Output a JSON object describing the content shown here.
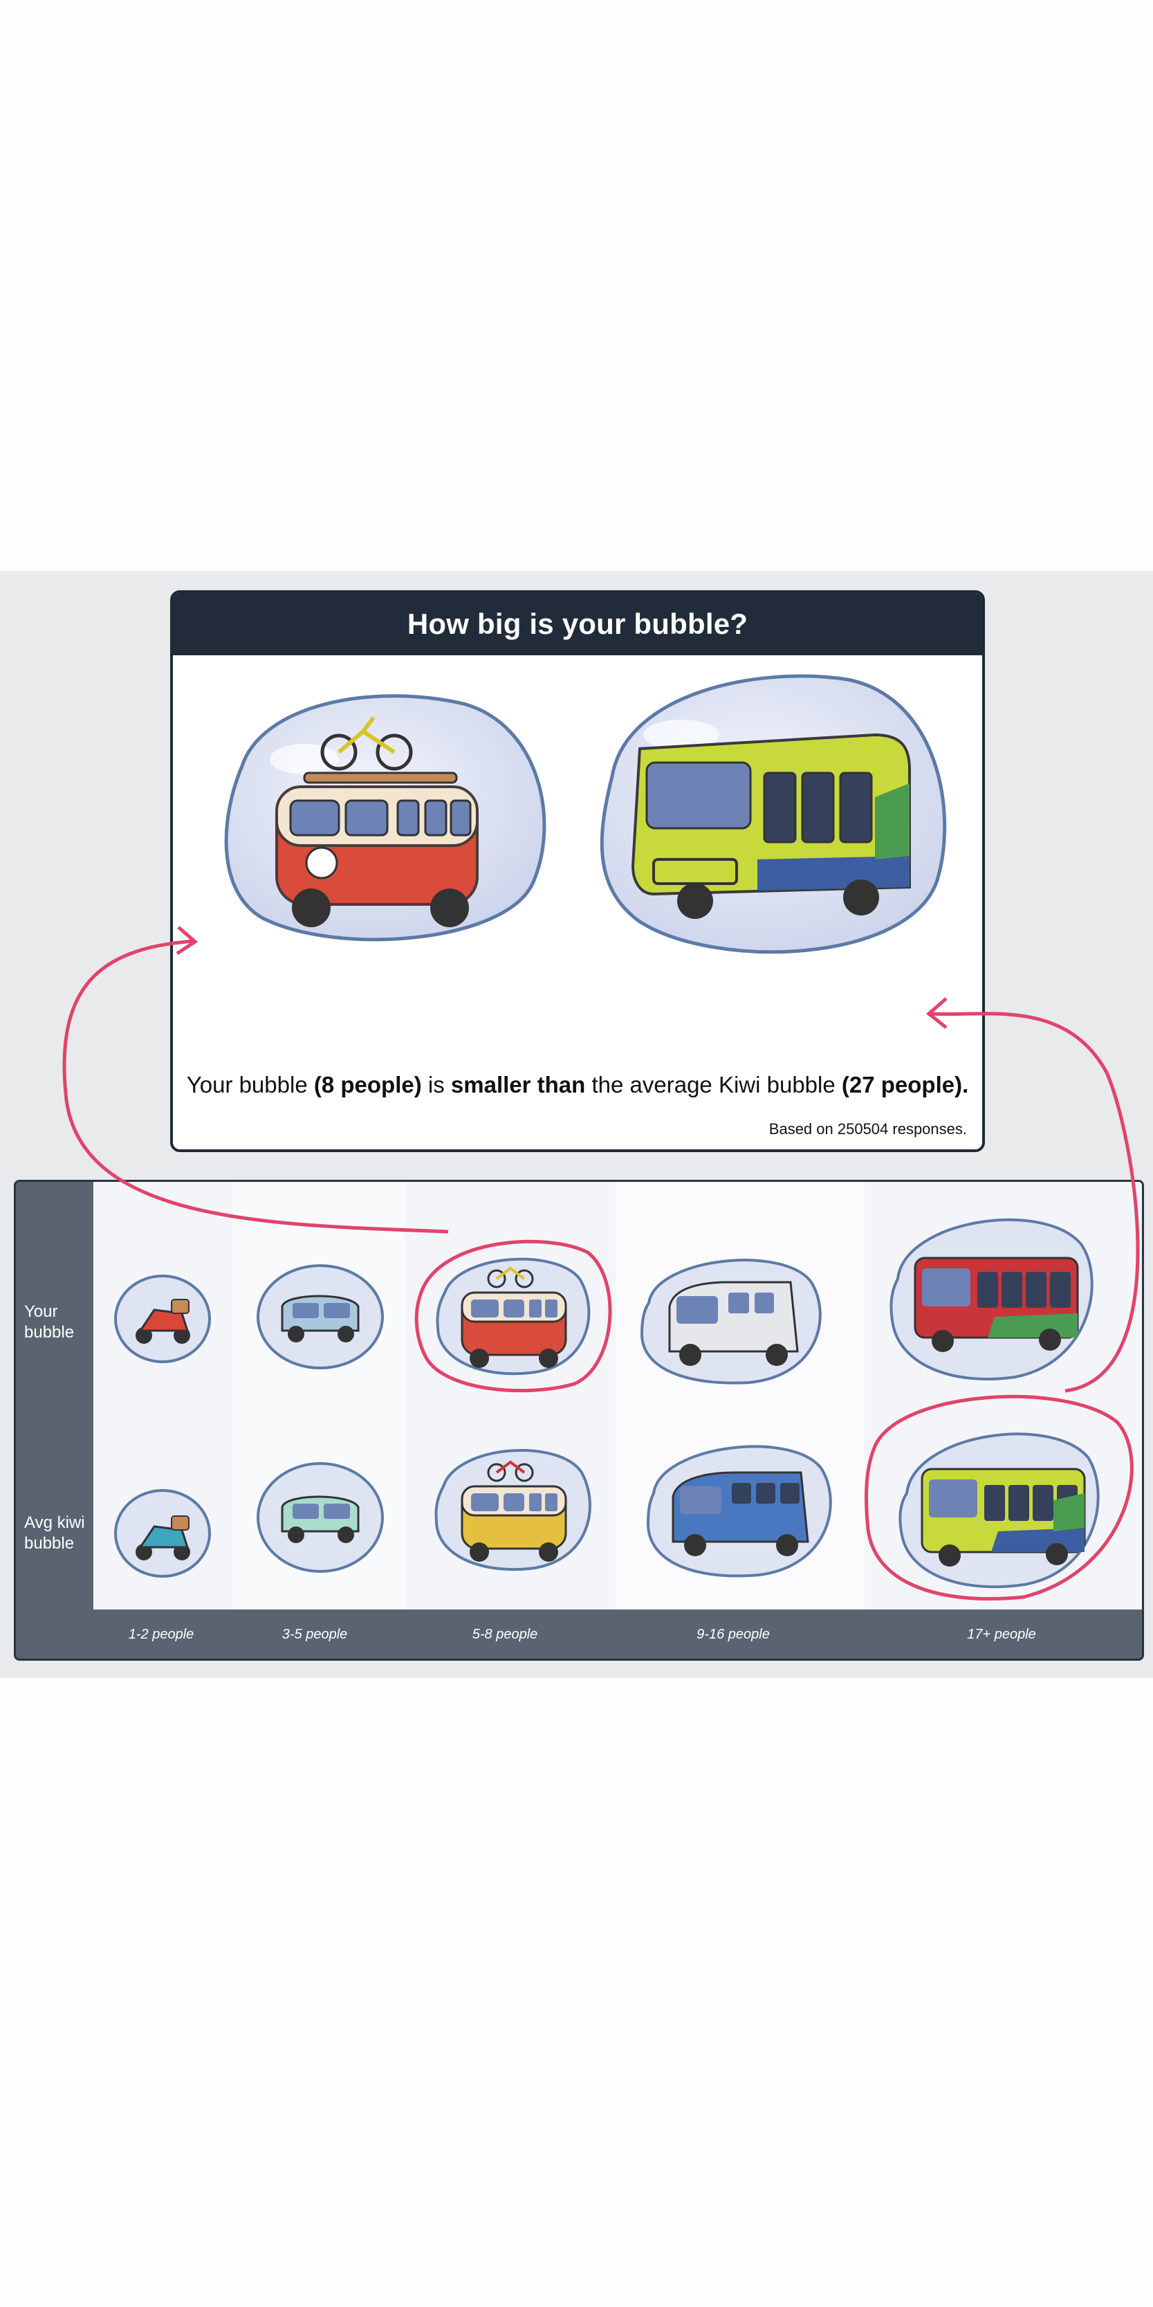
{
  "card": {
    "title": "How big is your bubble?",
    "sentence": {
      "part1": "Your bubble ",
      "your_count": "(8 people)",
      "part2": " is ",
      "comparison": "smaller than",
      "part3": " the average Kiwi bubble ",
      "avg_count": "(27 people)."
    },
    "note": "Based on 250504 responses."
  },
  "grid": {
    "row_labels": [
      "Your bubble",
      "Avg kiwi bubble"
    ],
    "columns": [
      "1-2 people",
      "3-5 people",
      "5-8 people",
      "9-16 people",
      "17+ people"
    ],
    "your_selected_column": "5-8 people",
    "avg_selected_column": "17+ people"
  },
  "colors": {
    "header": "#222b39",
    "highlight": "#e0446a",
    "bubble_fill": "#dfe4f3",
    "bubble_edge": "#5d7aa6"
  },
  "icons": {
    "your_bubble_big": "campervan-icon",
    "avg_bubble_big": "bus-icon",
    "row_your": [
      "scooter-icon",
      "car-icon",
      "campervan-icon",
      "minivan-icon",
      "bus-icon"
    ],
    "row_avg": [
      "scooter-icon",
      "car-icon",
      "campervan-icon",
      "minivan-icon",
      "bus-icon"
    ]
  }
}
